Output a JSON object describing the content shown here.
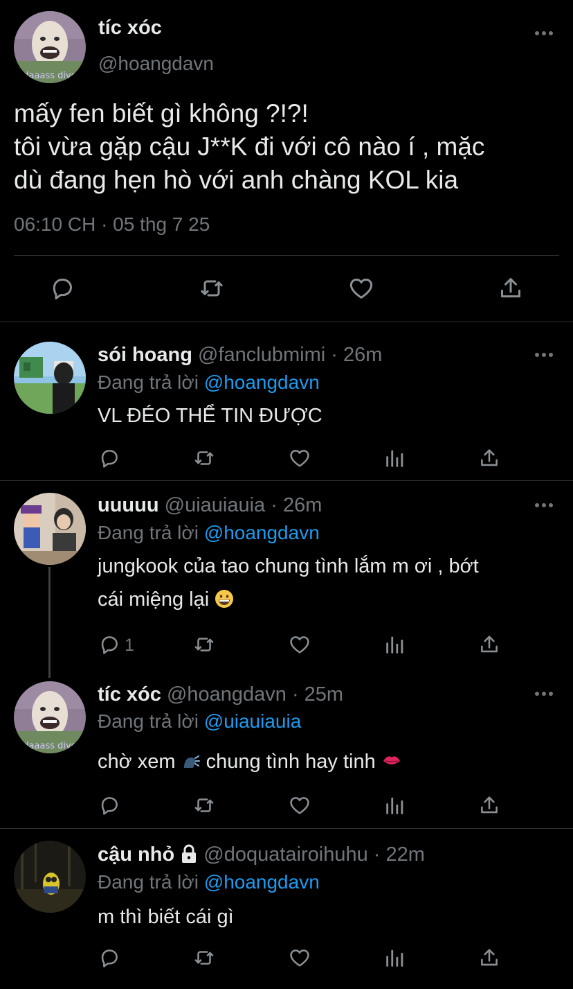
{
  "main_tweet": {
    "name": "tíc xóc",
    "handle": "@hoangdavn",
    "avatar_text": "daaass dive",
    "text_lines": [
      "mấy fen biết gì không ?!?!",
      "tôi vừa gặp cậu J**K đi với cô nào í , mặc",
      "dù đang hẹn hò với anh chàng KOL kia"
    ],
    "meta": "06:10 CH · 05 thg 7 25",
    "actions": [
      "reply-icon",
      "retweet-icon",
      "like-icon",
      "share-icon"
    ]
  },
  "replies": [
    {
      "name": "sói hoang",
      "handle_time": "@fanclubmimi · 26m",
      "replying_prefix": "Đang trả lời",
      "replying_to": "@hoangdavn",
      "text_lines": [
        "VL ĐÉO THỂ TIN ĐƯỢC"
      ],
      "reply_count": ""
    },
    {
      "name": "uuuuu",
      "handle_time": "@uiauiauia · 26m",
      "replying_prefix": "Đang trả lời",
      "replying_to": "@hoangdavn",
      "text_lines": [
        "jungkook của tao chung tình lắm m ơi , bớt",
        "cái miệng lại"
      ],
      "reply_count": "1"
    },
    {
      "name": "tíc xóc",
      "handle_time": "@hoangdavn · 25m",
      "replying_prefix": "Đang trả lời",
      "replying_to": "@uiauiauia",
      "text_before_emoji": "chờ xem",
      "text_after_emoji": "chung tình hay tinh",
      "avatar_text": "daaass dive",
      "reply_count": ""
    },
    {
      "name": "cậu nhỏ",
      "handle_time": "@doquatairoihuhu · 22m",
      "replying_prefix": "Đang trả lời",
      "replying_to": "@hoangdavn",
      "text_lines": [
        "m thì biết cái gì"
      ],
      "reply_count": ""
    }
  ],
  "colors": {
    "background": "#000000",
    "text": "#e7e9ea",
    "secondary": "#71767b",
    "accent": "#1d9bf0",
    "divider": "#2f3336"
  }
}
